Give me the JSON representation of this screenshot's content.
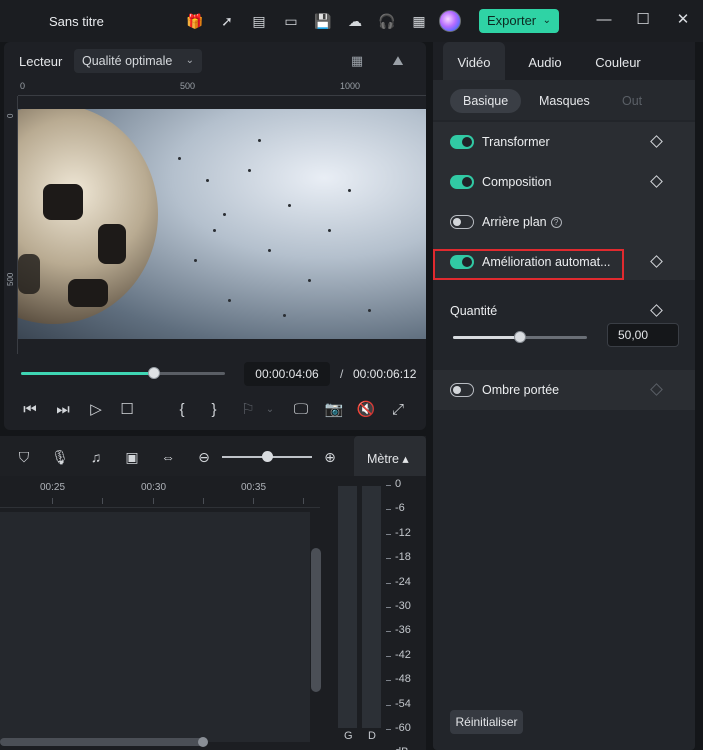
{
  "titlebar": {
    "title": "Sans titre",
    "icons": [
      "gift-icon",
      "send-icon",
      "media-icon",
      "layout-icon",
      "save-icon",
      "cloud-upload-icon",
      "headset-icon",
      "grid-icon"
    ],
    "export_label": "Exporter"
  },
  "player": {
    "label": "Lecteur",
    "quality": "Qualité optimale",
    "ruler_top": [
      "0",
      "500",
      "1000"
    ],
    "ruler_left": [
      "0",
      "500"
    ],
    "current_time": "00:00:04:06",
    "separator": "/",
    "total_time": "00:00:06:12",
    "progress": 0.65
  },
  "timeline": {
    "ruler_labels": [
      "00:25",
      "00:30",
      "00:35"
    ],
    "metre_label": "Mètre ▴",
    "zoom_level": 0.5
  },
  "meter": {
    "scale": [
      "0",
      "-6",
      "-12",
      "-18",
      "-24",
      "-30",
      "-36",
      "-42",
      "-48",
      "-54",
      "-60",
      "dB"
    ],
    "channels": [
      "G",
      "D"
    ]
  },
  "props": {
    "tabs": [
      "Vidéo",
      "Audio",
      "Couleur"
    ],
    "subtabs": [
      "Basique",
      "Masques",
      "Out"
    ],
    "rows": [
      {
        "label": "Transformer",
        "on": true
      },
      {
        "label": "Composition",
        "on": true
      },
      {
        "label": "Arrière plan",
        "on": false
      },
      {
        "label": "Amélioration automat...",
        "on": true
      }
    ],
    "quantity_label": "Quantité",
    "quantity_value": "50,00",
    "quantity_fraction": 0.5,
    "shadow_label": "Ombre portée",
    "reset_label": "Réinitialiser"
  },
  "colors": {
    "accent": "#2fd3a5",
    "highlight": "#e02a2f"
  }
}
